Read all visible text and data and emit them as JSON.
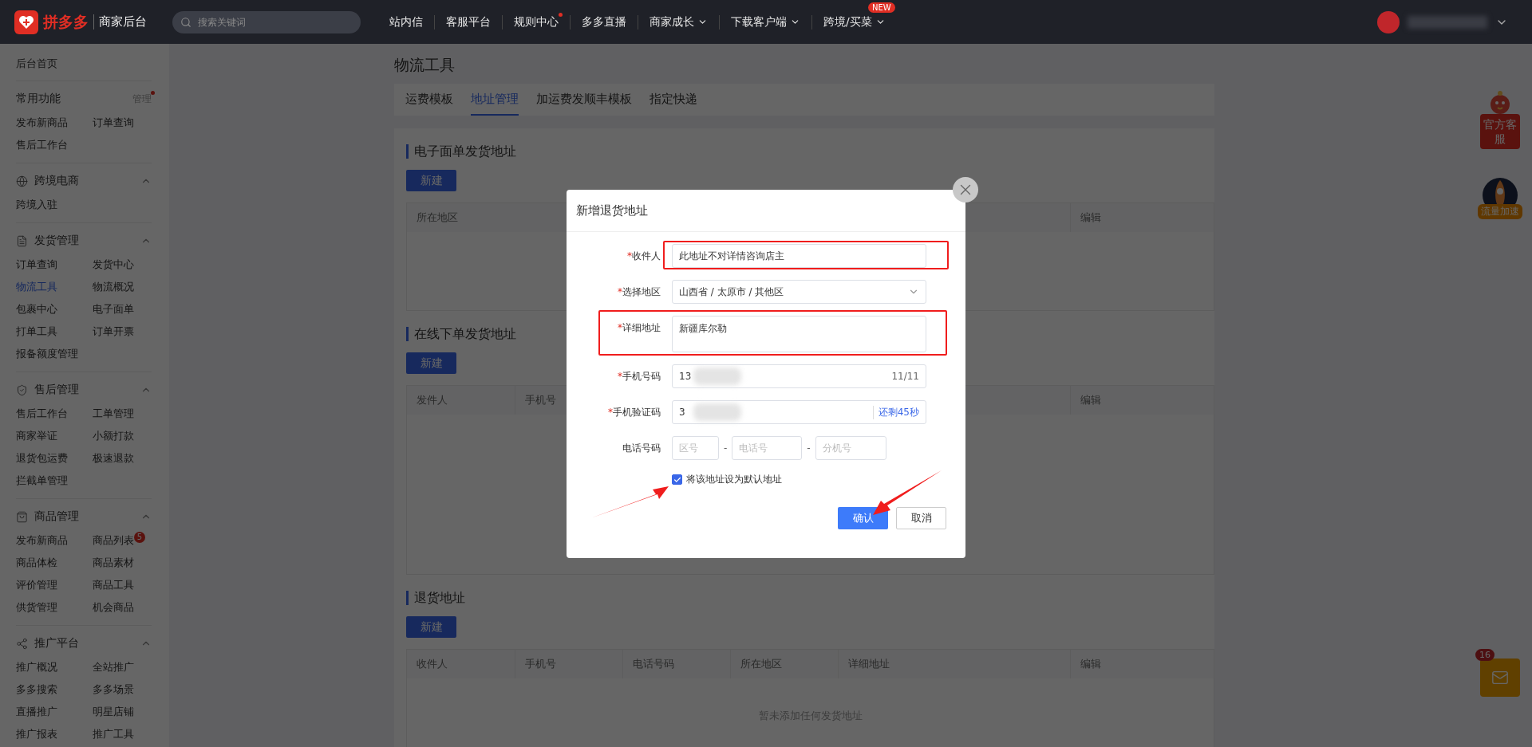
{
  "top_bar": {
    "logo_text": "拼多多",
    "subtitle": "商家后台",
    "search": {
      "placeholder": "搜索关键词"
    },
    "nav": [
      {
        "label": "站内信",
        "dot": false,
        "dropdown": false
      },
      {
        "label": "客服平台",
        "dot": false,
        "dropdown": false
      },
      {
        "label": "规则中心",
        "dot": true,
        "dropdown": false
      },
      {
        "label": "多多直播",
        "dot": false,
        "dropdown": false
      },
      {
        "label": "商家成长",
        "dot": false,
        "dropdown": true
      },
      {
        "label": "下载客户端",
        "dot": false,
        "dropdown": true
      },
      {
        "label": "跨境/买菜",
        "dot": false,
        "dropdown": true,
        "badge": "NEW"
      }
    ]
  },
  "sidebar": {
    "home": "后台首页",
    "favorites": {
      "title": "常用功能",
      "manage": "管理",
      "manage_dot": true,
      "items": [
        {
          "label": "发布新商品",
          "selected": false
        },
        {
          "label": "订单查询",
          "selected": false
        },
        {
          "label": "售后工作台",
          "selected": false
        }
      ]
    },
    "groups": [
      {
        "title": "跨境电商",
        "expanded": true,
        "items": [
          {
            "label": "跨境入驻",
            "selected": false
          }
        ]
      },
      {
        "title": "发货管理",
        "expanded": true,
        "items": [
          {
            "label": "订单查询",
            "selected": false
          },
          {
            "label": "发货中心",
            "selected": false
          },
          {
            "label": "物流工具",
            "selected": true
          },
          {
            "label": "物流概况",
            "selected": false
          },
          {
            "label": "包裹中心",
            "selected": false
          },
          {
            "label": "电子面单",
            "selected": false
          },
          {
            "label": "打单工具",
            "selected": false
          },
          {
            "label": "订单开票",
            "selected": false
          },
          {
            "label": "报备额度管理",
            "selected": false
          }
        ]
      },
      {
        "title": "售后管理",
        "expanded": true,
        "items": [
          {
            "label": "售后工作台",
            "selected": false
          },
          {
            "label": "工单管理",
            "selected": false
          },
          {
            "label": "商家举证",
            "selected": false
          },
          {
            "label": "小额打款",
            "selected": false
          },
          {
            "label": "退货包运费",
            "selected": false
          },
          {
            "label": "极速退款",
            "selected": false
          },
          {
            "label": "拦截单管理",
            "selected": false
          }
        ]
      },
      {
        "title": "商品管理",
        "expanded": true,
        "items": [
          {
            "label": "发布新商品",
            "selected": false
          },
          {
            "label": "商品列表",
            "selected": false,
            "badge": "5"
          },
          {
            "label": "商品体检",
            "selected": false
          },
          {
            "label": "商品素材",
            "selected": false
          },
          {
            "label": "评价管理",
            "selected": false
          },
          {
            "label": "商品工具",
            "selected": false
          },
          {
            "label": "供货管理",
            "selected": false
          },
          {
            "label": "机会商品",
            "selected": false
          }
        ]
      },
      {
        "title": "推广平台",
        "expanded": true,
        "items": [
          {
            "label": "推广概况",
            "selected": false
          },
          {
            "label": "全站推广",
            "selected": false
          },
          {
            "label": "多多搜索",
            "selected": false
          },
          {
            "label": "多多场景",
            "selected": false
          },
          {
            "label": "直播推广",
            "selected": false
          },
          {
            "label": "明星店铺",
            "selected": false
          },
          {
            "label": "推广报表",
            "selected": false
          },
          {
            "label": "推广工具",
            "selected": false
          }
        ]
      }
    ]
  },
  "page": {
    "title": "物流工具",
    "tabs": [
      {
        "label": "运费模板",
        "selected": false
      },
      {
        "label": "地址管理",
        "selected": true
      },
      {
        "label": "加运费发顺丰模板",
        "selected": false
      },
      {
        "label": "指定快递",
        "selected": false
      }
    ],
    "sections": [
      {
        "title": "电子面单发货地址",
        "new_button": "新建",
        "columns": [
          "所在地区",
          "编辑"
        ]
      },
      {
        "title": "在线下单发货地址",
        "new_button": "新建",
        "columns": [
          "发件人",
          "手机号",
          "编辑"
        ]
      },
      {
        "title": "退货地址",
        "new_button": "新建",
        "columns": [
          "收件人",
          "手机号",
          "电话号码",
          "所在地区",
          "详细地址",
          "编辑"
        ],
        "empty_text": "暂未添加任何发货地址"
      }
    ]
  },
  "floating": {
    "service": "官方客服",
    "boost": "流量加速",
    "mail_badge": "16"
  },
  "dialog": {
    "title": "新增退货地址",
    "fields": [
      {
        "kind": "text",
        "label": "收件人",
        "required": true,
        "required_mark": "*",
        "value": "此地址不对详情咨询店主",
        "highlighted": true
      },
      {
        "kind": "select",
        "label": "选择地区",
        "required": true,
        "required_mark": "*",
        "value": "山西省 / 太原市 / 其他区",
        "highlighted": false
      },
      {
        "kind": "textarea",
        "label": "详细地址",
        "required": true,
        "required_mark": "*",
        "value": "新疆库尔勒",
        "highlighted": true
      },
      {
        "kind": "counter",
        "label": "手机号码",
        "required": true,
        "required_mark": "*",
        "value": "13",
        "suffix": "11/11",
        "redacted": true,
        "highlighted": false
      },
      {
        "kind": "code",
        "label": "手机验证码",
        "required": true,
        "required_mark": "*",
        "value": "3",
        "suffix": "还剩45秒",
        "redacted": true,
        "highlighted": false
      },
      {
        "kind": "phone",
        "label": "电话号码",
        "parts": [
          {
            "placeholder": "区号"
          },
          {
            "placeholder": "电话号"
          },
          {
            "placeholder": "分机号"
          }
        ],
        "separators": [
          "-",
          "-"
        ],
        "highlighted": false
      }
    ],
    "default_checkbox": {
      "label": "将该地址设为默认地址",
      "checked": true
    },
    "buttons": [
      {
        "label": "确认",
        "kind": "primary"
      },
      {
        "label": "取消",
        "kind": "secondary"
      }
    ]
  }
}
